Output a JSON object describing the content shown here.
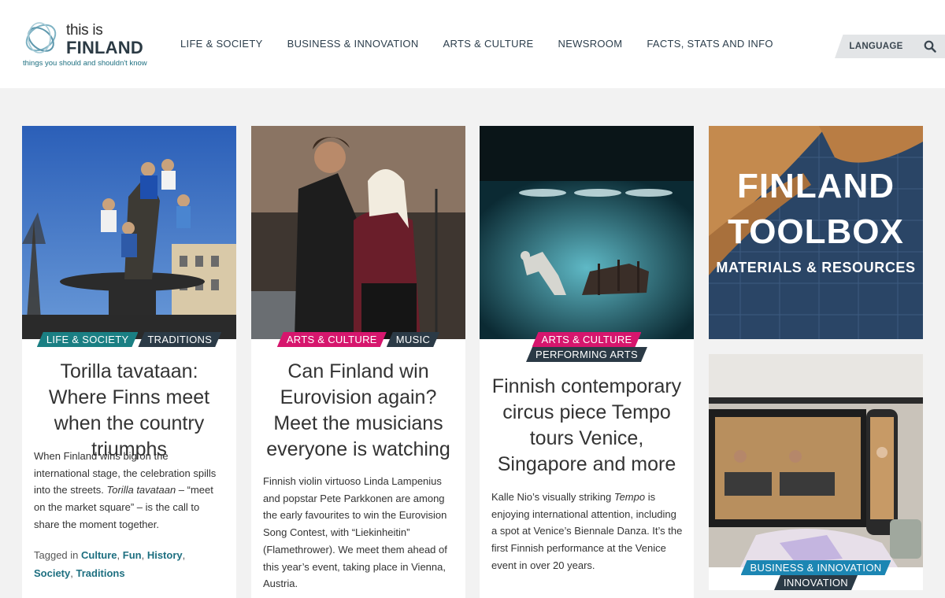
{
  "site": {
    "logo_line1": "this is",
    "logo_line2": "FINLAND",
    "tagline": "things you should and shouldn't know"
  },
  "nav": {
    "items": [
      "LIFE & SOCIETY",
      "BUSINESS & INNOVATION",
      "ARTS & CULTURE",
      "NEWSROOM",
      "FACTS, STATS AND INFO"
    ]
  },
  "header": {
    "language_label": "LANGUAGE"
  },
  "cards": [
    {
      "tags": [
        "LIFE & SOCIETY",
        "TRADITIONS"
      ],
      "title": "Torilla tavataan: Where Finns meet when the country triumphs",
      "excerpt_parts": [
        "When Finland wins big on the international stage, the celebration spills into the streets. ",
        "Torilla tavataan",
        " – “meet on the market square” – is the call to share the moment together."
      ],
      "tagged_in_label": "Tagged in",
      "tagged_in": [
        "Culture",
        "Fun",
        "History",
        "Society",
        "Traditions"
      ]
    },
    {
      "tags": [
        "ARTS & CULTURE",
        "MUSIC"
      ],
      "title": "Can Finland win Eurovision again? Meet the musicians everyone is watching",
      "excerpt": "Finnish violin virtuoso Linda Lampenius and popstar Pete Parkkonen are among the early favourites to win the Eurovision Song Contest, with “Liekinheitin” (Flamethrower). We meet them ahead of this year’s event, taking place in Vienna, Austria."
    },
    {
      "tags": [
        "ARTS & CULTURE",
        "PERFORMING ARTS"
      ],
      "title": "Finnish contemporary circus piece Tempo tours Venice, Singapore and more",
      "excerpt_parts": [
        "Kalle Nio’s visually striking ",
        "Tempo",
        " is enjoying international attention, including a spot at Venice’s Biennale Danza. It’s the first Finnish performance at the Venice event in over 20 years."
      ]
    }
  ],
  "toolbox": {
    "line1": "FINLAND",
    "line2": "TOOLBOX",
    "line3": "MATERIALS & RESOURCES"
  },
  "card4": {
    "tags": [
      "BUSINESS & INNOVATION",
      "INNOVATION"
    ]
  },
  "colors": {
    "teal": "#1a7f83",
    "dark": "#2b3a46",
    "pink": "#d6166d",
    "blue": "#1c86b3"
  }
}
